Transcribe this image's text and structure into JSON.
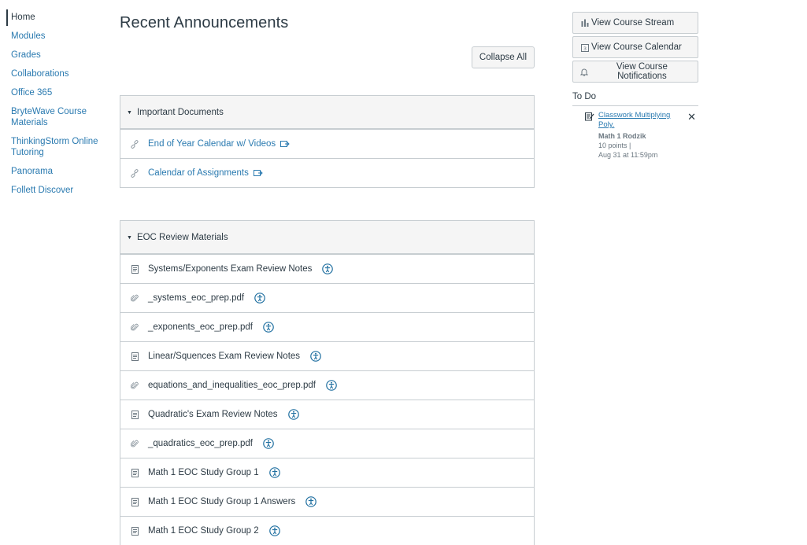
{
  "nav": {
    "items": [
      {
        "label": "Home",
        "active": true
      },
      {
        "label": "Modules"
      },
      {
        "label": "Grades"
      },
      {
        "label": "Collaborations"
      },
      {
        "label": "Office 365"
      },
      {
        "label": "BryteWave Course Materials"
      },
      {
        "label": "ThinkingStorm Online Tutoring"
      },
      {
        "label": "Panorama"
      },
      {
        "label": "Follett Discover"
      }
    ]
  },
  "main": {
    "title": "Recent Announcements",
    "collapse_all": "Collapse All",
    "modules": [
      {
        "title": "Important Documents",
        "items": [
          {
            "title": "End of Year Calendar w/ Videos",
            "icon": "link-icon",
            "external": true
          },
          {
            "title": "Calendar of Assignments",
            "icon": "link-icon",
            "external": true
          }
        ]
      },
      {
        "title": "EOC Review Materials",
        "items": [
          {
            "title": "Systems/Exponents Exam Review Notes",
            "icon": "page-icon"
          },
          {
            "title": "_systems_eoc_prep.pdf",
            "icon": "attachment-icon"
          },
          {
            "title": "_exponents_eoc_prep.pdf",
            "icon": "attachment-icon"
          },
          {
            "title": "Linear/Squences Exam Review Notes",
            "icon": "page-icon"
          },
          {
            "title": "equations_and_inequalities_eoc_prep.pdf",
            "icon": "attachment-icon"
          },
          {
            "title": "Quadratic's Exam Review Notes",
            "icon": "page-icon"
          },
          {
            "title": "_quadratics_eoc_prep.pdf",
            "icon": "attachment-icon"
          },
          {
            "title": "Math 1 EOC Study Group 1",
            "icon": "page-icon"
          },
          {
            "title": "Math 1 EOC Study Group 1 Answers",
            "icon": "page-icon"
          },
          {
            "title": "Math 1 EOC Study Group 2",
            "icon": "page-icon"
          }
        ]
      }
    ]
  },
  "sidebar": {
    "buttons": [
      {
        "label": "View Course Stream",
        "icon": "bar-chart-icon"
      },
      {
        "label": "View Course Calendar",
        "icon": "calendar-icon"
      },
      {
        "label": "View Course Notifications",
        "icon": "bell-icon"
      }
    ],
    "todo": {
      "heading": "To Do",
      "item": {
        "title": "Classwork Multiplying Poly.",
        "course": "Math 1 Rodzik",
        "points": "10 points  |",
        "due": "Aug 31 at 11:59pm",
        "icon": "assignment-icon",
        "dismiss": "✕"
      }
    }
  }
}
